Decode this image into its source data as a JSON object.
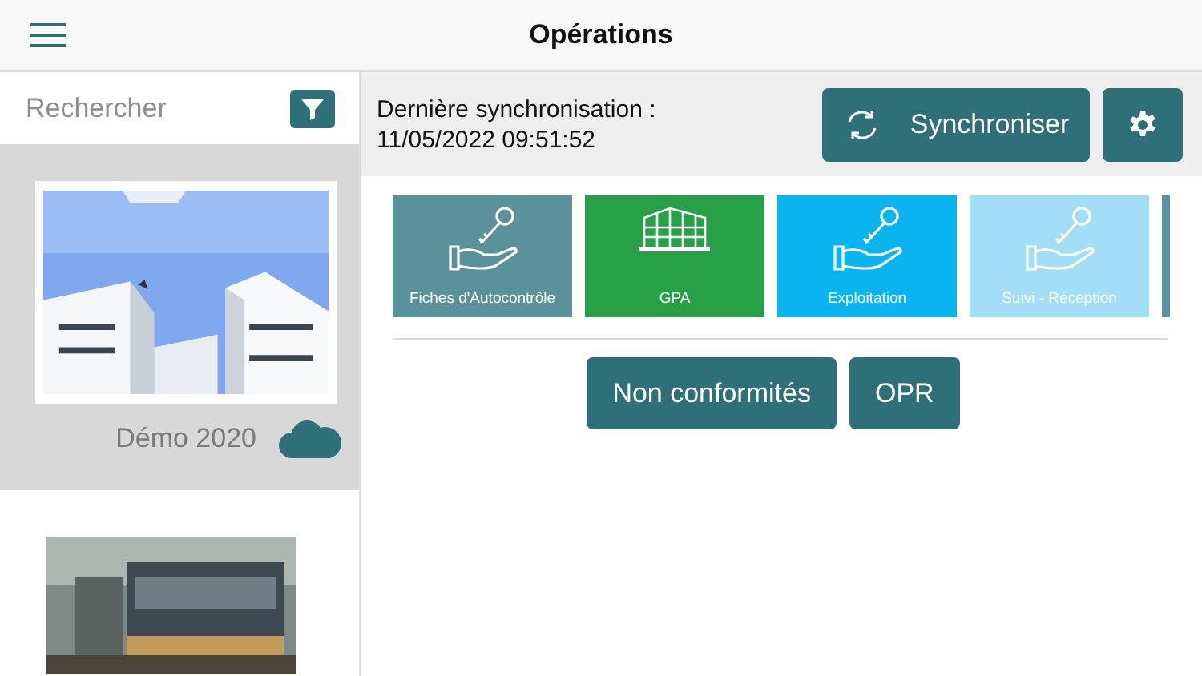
{
  "header": {
    "title": "Opérations"
  },
  "search": {
    "placeholder": "Rechercher"
  },
  "projects": [
    {
      "name": "Démo 2020",
      "selected": true,
      "synced": true,
      "kind": "picture"
    },
    {
      "selected": false,
      "kind": "picture"
    }
  ],
  "sync": {
    "label": "Dernière synchronisation :",
    "date": "11/05/2022 09:51:52",
    "button": "Synchroniser"
  },
  "tiles": [
    {
      "label": "Fiches d'Autocontrôle",
      "color": "#5b9199",
      "kind": "key"
    },
    {
      "label": "GPA",
      "color": "#27a047",
      "kind": "building"
    },
    {
      "label": "Exploitation",
      "color": "#0ab4ef",
      "kind": "key"
    },
    {
      "label": "Suivi - Réception",
      "color": "#a2dff6",
      "kind": "key"
    },
    {
      "color": "#5b9199"
    }
  ],
  "buttons": [
    "Non conformités",
    "OPR"
  ]
}
